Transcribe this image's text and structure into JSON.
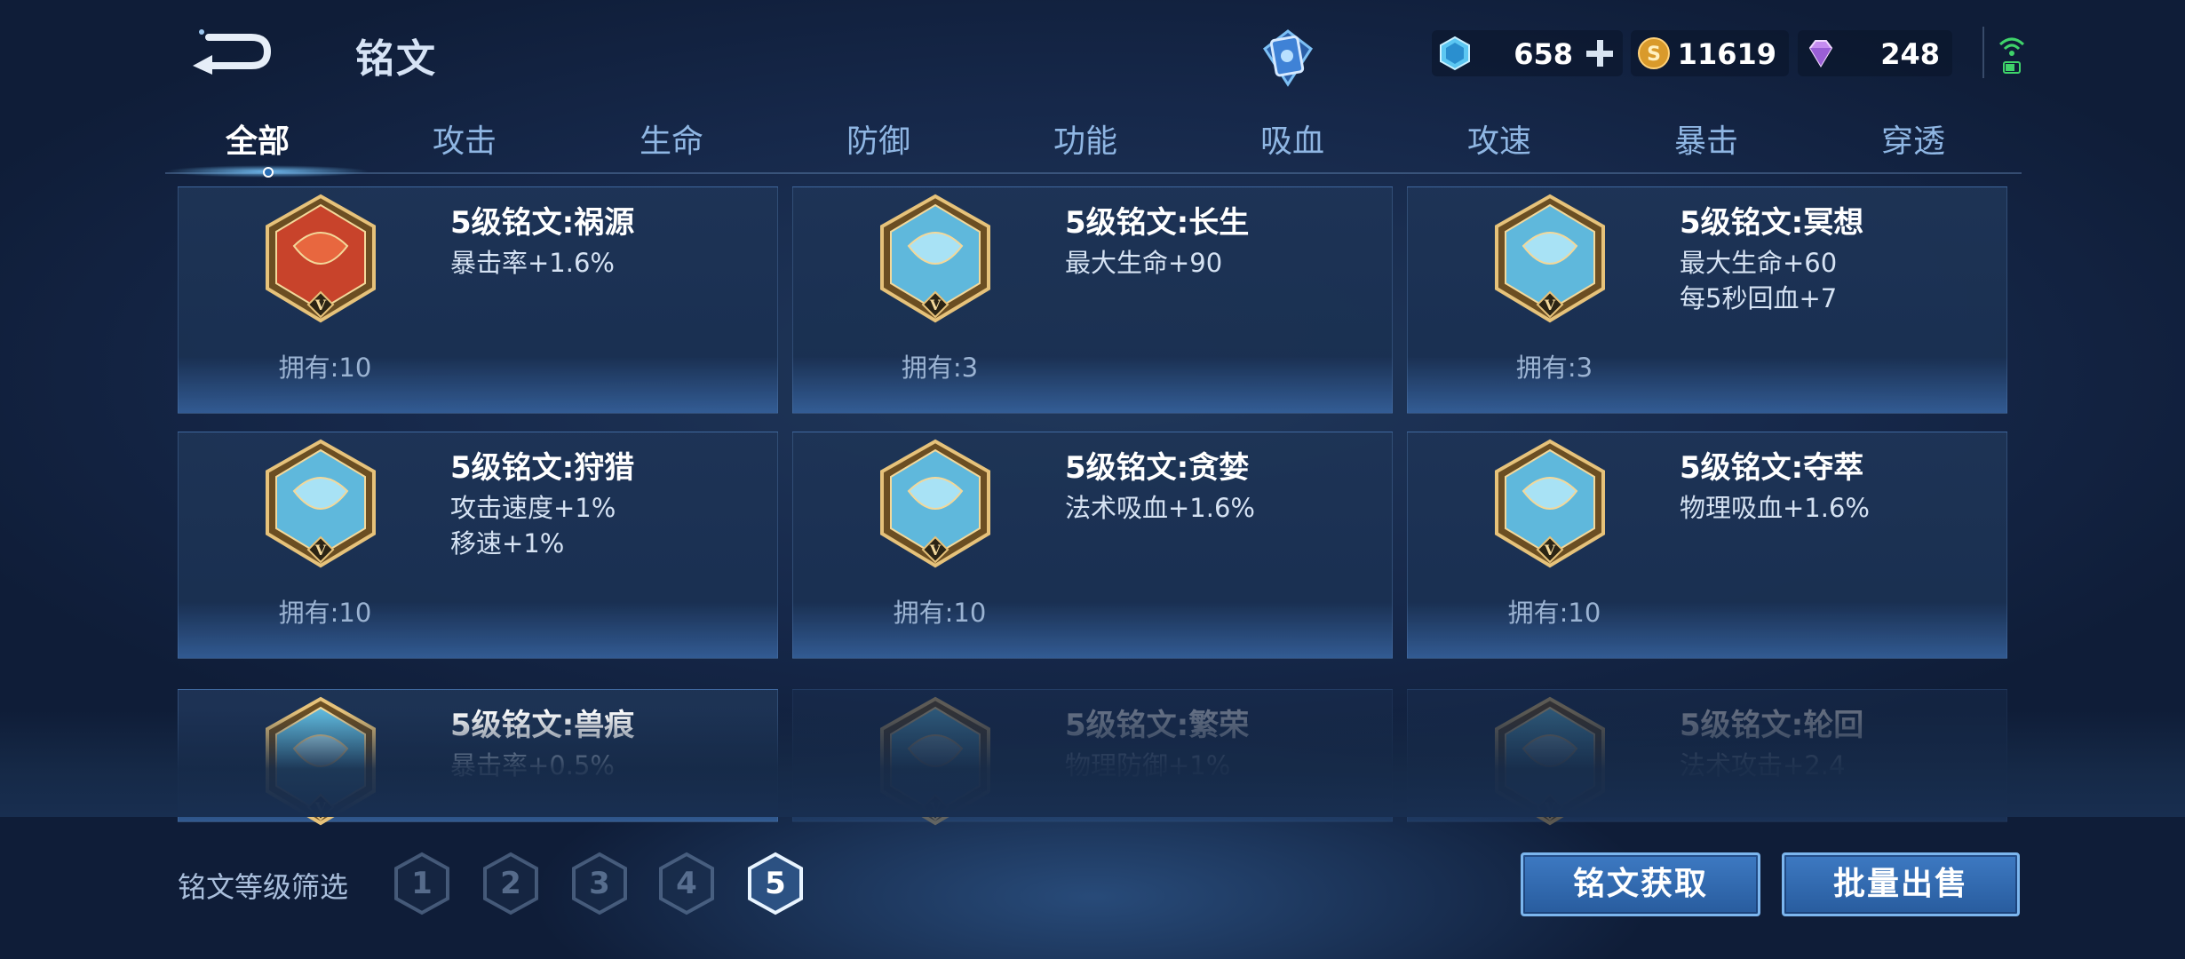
{
  "header": {
    "title": "铭文",
    "currencies": [
      {
        "name": "gem",
        "value": "658"
      },
      {
        "name": "gold",
        "value": "11619"
      },
      {
        "name": "diamond",
        "value": "248"
      }
    ]
  },
  "tabs": [
    "全部",
    "攻击",
    "生命",
    "防御",
    "功能",
    "吸血",
    "攻速",
    "暴击",
    "穿透"
  ],
  "active_tab": "全部",
  "runes": [
    {
      "name": "5级铭文:祸源",
      "attrs": [
        "暴击率+1.6%"
      ],
      "owned": "拥有:10",
      "color": "red"
    },
    {
      "name": "5级铭文:长生",
      "attrs": [
        "最大生命+90"
      ],
      "owned": "拥有:3",
      "color": "blue"
    },
    {
      "name": "5级铭文:冥想",
      "attrs": [
        "最大生命+60",
        "每5秒回血+7"
      ],
      "owned": "拥有:3",
      "color": "blue"
    },
    {
      "name": "5级铭文:狩猎",
      "attrs": [
        "攻击速度+1%",
        "移速+1%"
      ],
      "owned": "拥有:10",
      "color": "blue"
    },
    {
      "name": "5级铭文:贪婪",
      "attrs": [
        "法术吸血+1.6%"
      ],
      "owned": "拥有:10",
      "color": "blue"
    },
    {
      "name": "5级铭文:夺萃",
      "attrs": [
        "物理吸血+1.6%"
      ],
      "owned": "拥有:10",
      "color": "blue"
    },
    {
      "name": "5级铭文:兽痕",
      "attrs": [
        "暴击率+0.5%"
      ],
      "owned": "",
      "color": "blue"
    },
    {
      "name": "5级铭文:繁荣",
      "attrs": [
        "物理防御+1%"
      ],
      "owned": "",
      "color": "blue"
    },
    {
      "name": "5级铭文:轮回",
      "attrs": [
        "法术攻击+2.4"
      ],
      "owned": "",
      "color": "blue"
    }
  ],
  "filter": {
    "label": "铭文等级筛选",
    "levels": [
      "1",
      "2",
      "3",
      "4",
      "5"
    ],
    "active": "5"
  },
  "buttons": {
    "get": "铭文获取",
    "sell": "批量出售"
  },
  "colors": {
    "accent": "#7cb6ee",
    "background": "#1a2f52",
    "tab_active": "#ffffff",
    "tab_inactive": "#8fb6e3"
  }
}
